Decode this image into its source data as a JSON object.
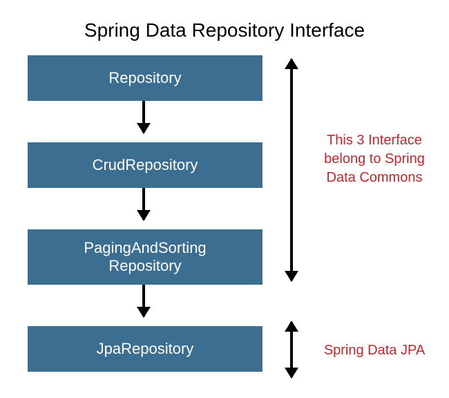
{
  "title": "Spring Data Repository Interface",
  "boxes": {
    "b1": "Repository",
    "b2": "CrudRepository",
    "b3": "PagingAndSorting\nRepository",
    "b4": "JpaRepository"
  },
  "notes": {
    "n1": "This 3 Interface belong to Spring Data Commons",
    "n2": "Spring Data JPA"
  },
  "colors": {
    "box_bg": "#3c6e91",
    "note_color": "#c1272d"
  }
}
